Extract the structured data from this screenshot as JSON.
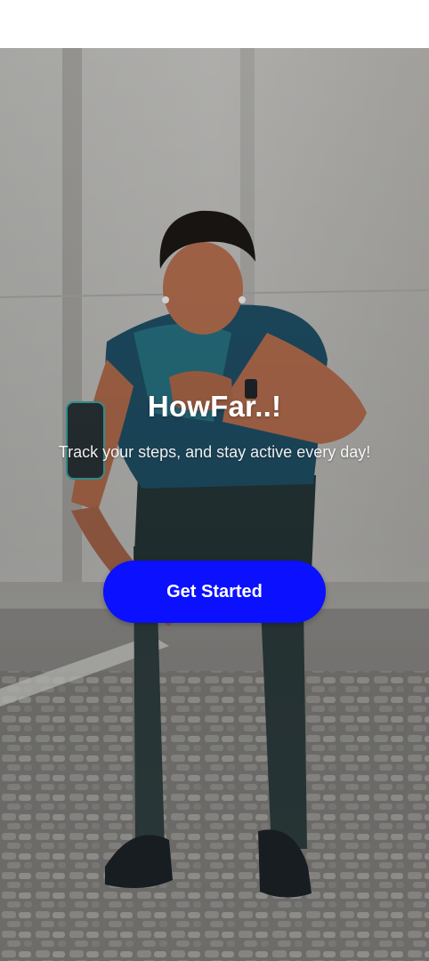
{
  "app": {
    "title": "HowFar..!",
    "subtitle": "Track your steps, and stay active every day!"
  },
  "actions": {
    "get_started_label": "Get Started"
  },
  "colors": {
    "primary_button": "#0b10ff",
    "text_on_image": "#ffffff"
  },
  "hero_image": {
    "icon": "runner-checking-smartwatch-photo"
  }
}
